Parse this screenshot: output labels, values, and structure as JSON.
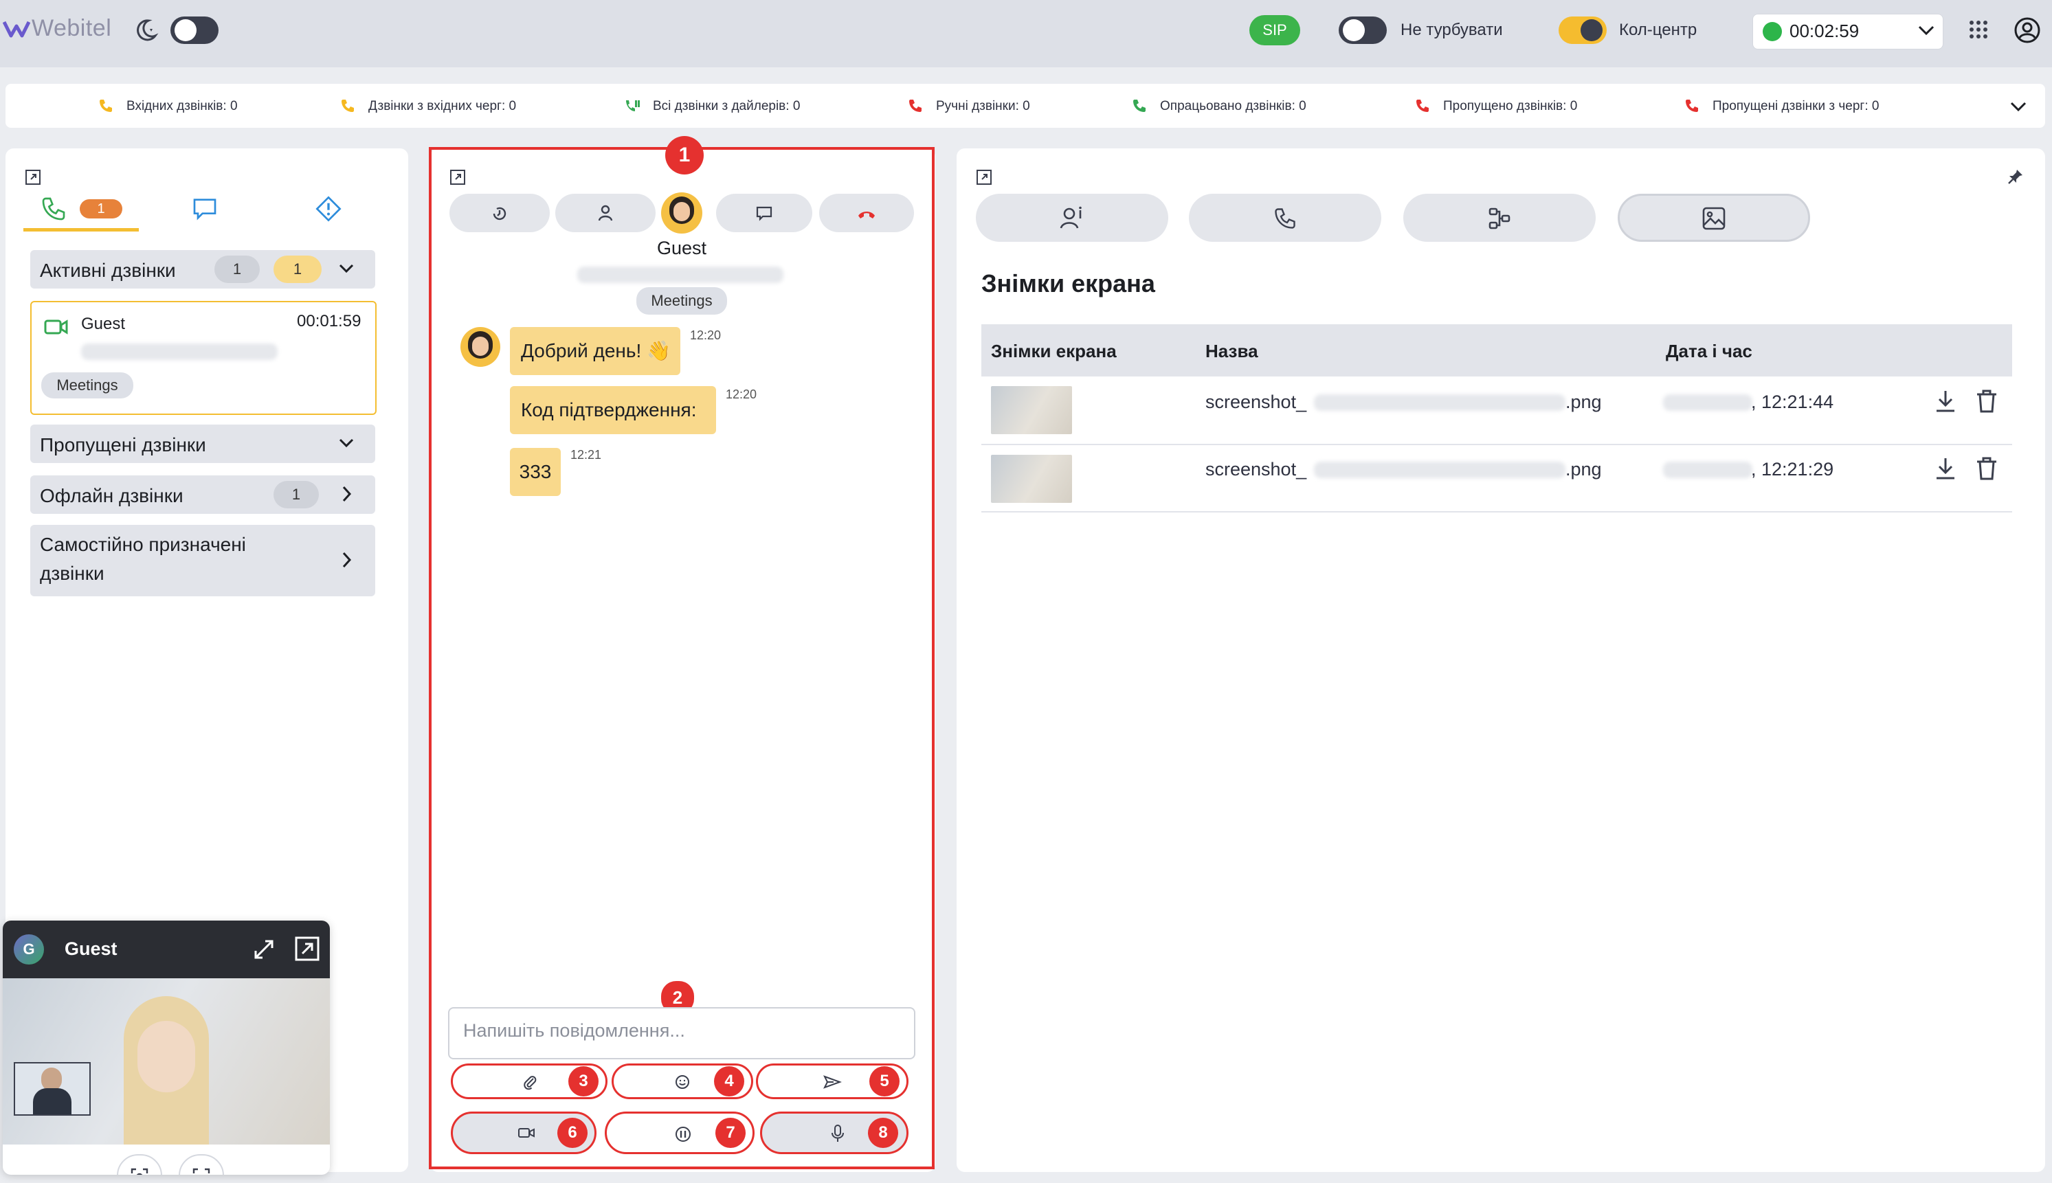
{
  "app": {
    "logo": "Webitel",
    "sip_label": "SIP",
    "dnd_label": "Не турбувати",
    "callcenter_label": "Кол-центр",
    "timer": "00:02:59"
  },
  "stats": [
    {
      "label": "Вхідних дзвінків: 0",
      "icon": "incoming-call-icon",
      "color": "#f5b820"
    },
    {
      "label": "Дзвінки з вхідних черг: 0",
      "icon": "queue-call-icon",
      "color": "#f5b820"
    },
    {
      "label": "Всі дзвінки з дайлерів: 0",
      "icon": "dialer-icon",
      "color": "#35a853"
    },
    {
      "label": "Ручні дзвінки: 0",
      "icon": "manual-call-icon",
      "color": "#e5312f"
    },
    {
      "label": "Опрацьовано дзвінків: 0",
      "icon": "processed-call-icon",
      "color": "#35a853"
    },
    {
      "label": "Пропущено дзвінків: 0",
      "icon": "missed-call-icon",
      "color": "#e5312f"
    },
    {
      "label": "Пропущені дзвінки з черг: 0",
      "icon": "missed-queue-icon",
      "color": "#e5312f"
    }
  ],
  "left": {
    "tab_calls_badge": "1",
    "sections": {
      "active": {
        "label": "Активні дзвінки",
        "count1": "1",
        "count2": "1"
      },
      "missed": {
        "label": "Пропущені дзвінки"
      },
      "offline": {
        "label": "Офлайн дзвінки",
        "count": "1"
      },
      "self_assigned": {
        "label": "Самостійно призначені дзвінки"
      }
    },
    "active_call": {
      "name": "Guest",
      "duration": "00:01:59",
      "tag": "Meetings"
    }
  },
  "video": {
    "avatar_letter": "G",
    "name": "Guest"
  },
  "chat": {
    "contact_name": "Guest",
    "tag": "Meetings",
    "messages": [
      {
        "text": "Добрий день! 👋",
        "time": "12:20"
      },
      {
        "text": "Код підтвердження:",
        "time": "12:20"
      },
      {
        "text": "333",
        "time": "12:21"
      }
    ],
    "input_placeholder": "Напишіть повідомлення...",
    "markers": {
      "m1": "1",
      "m2": "2",
      "m3": "3",
      "m4": "4",
      "m5": "5",
      "m6": "6",
      "m7": "7",
      "m8": "8"
    }
  },
  "screenshots": {
    "title": "Знімки екрана",
    "columns": [
      "Знімки екрана",
      "Назва",
      "Дата і час"
    ],
    "rows": [
      {
        "name_prefix": "screenshot_",
        "name_suffix": ".png",
        "time": ", 12:21:44"
      },
      {
        "name_prefix": "screenshot_",
        "name_suffix": ".png",
        "time": ", 12:21:29"
      }
    ]
  }
}
